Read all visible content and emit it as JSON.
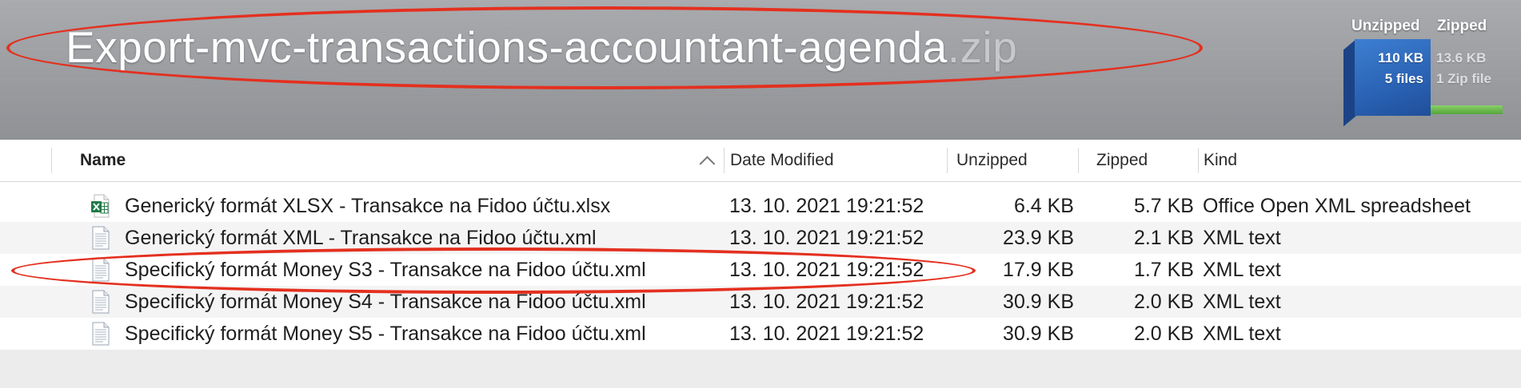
{
  "header": {
    "archive_name": "Export-mvc-transactions-accountant-agenda",
    "archive_ext": ".zip",
    "stats": {
      "unzipped_label": "Unzipped",
      "zipped_label": "Zipped",
      "unzipped_size": "110 KB",
      "unzipped_count": "5 files",
      "zipped_size": "13.6 KB",
      "zipped_count": "1 Zip file"
    }
  },
  "columns": {
    "name": "Name",
    "date": "Date Modified",
    "unzipped": "Unzipped",
    "zipped": "Zipped",
    "kind": "Kind"
  },
  "files": [
    {
      "name": "Generický formát XLSX - Transakce na Fidoo účtu.xlsx",
      "date": "13. 10. 2021 19:21:52",
      "unzipped": "6.4 KB",
      "zipped": "5.7 KB",
      "kind": "Office Open XML spreadsheet",
      "icon": "excel-file-icon"
    },
    {
      "name": "Generický formát XML - Transakce na Fidoo účtu.xml",
      "date": "13. 10. 2021 19:21:52",
      "unzipped": "23.9 KB",
      "zipped": "2.1 KB",
      "kind": "XML text",
      "icon": "xml-file-icon"
    },
    {
      "name": "Specifický formát Money S3 - Transakce na Fidoo účtu.xml",
      "date": "13. 10. 2021 19:21:52",
      "unzipped": "17.9 KB",
      "zipped": "1.7 KB",
      "kind": "XML text",
      "icon": "xml-file-icon"
    },
    {
      "name": "Specifický formát Money S4 - Transakce na Fidoo účtu.xml",
      "date": "13. 10. 2021 19:21:52",
      "unzipped": "30.9 KB",
      "zipped": "2.0 KB",
      "kind": "XML text",
      "icon": "xml-file-icon"
    },
    {
      "name": "Specifický formát Money S5 - Transakce na Fidoo účtu.xml",
      "date": "13. 10. 2021 19:21:52",
      "unzipped": "30.9 KB",
      "zipped": "2.0 KB",
      "kind": "XML text",
      "icon": "xml-file-icon"
    }
  ],
  "colors": {
    "annotation_red": "#e4301f",
    "excel_green": "#1f7a45",
    "unzipped_blue": "#2a62b4",
    "zipped_green": "#5fb043"
  }
}
